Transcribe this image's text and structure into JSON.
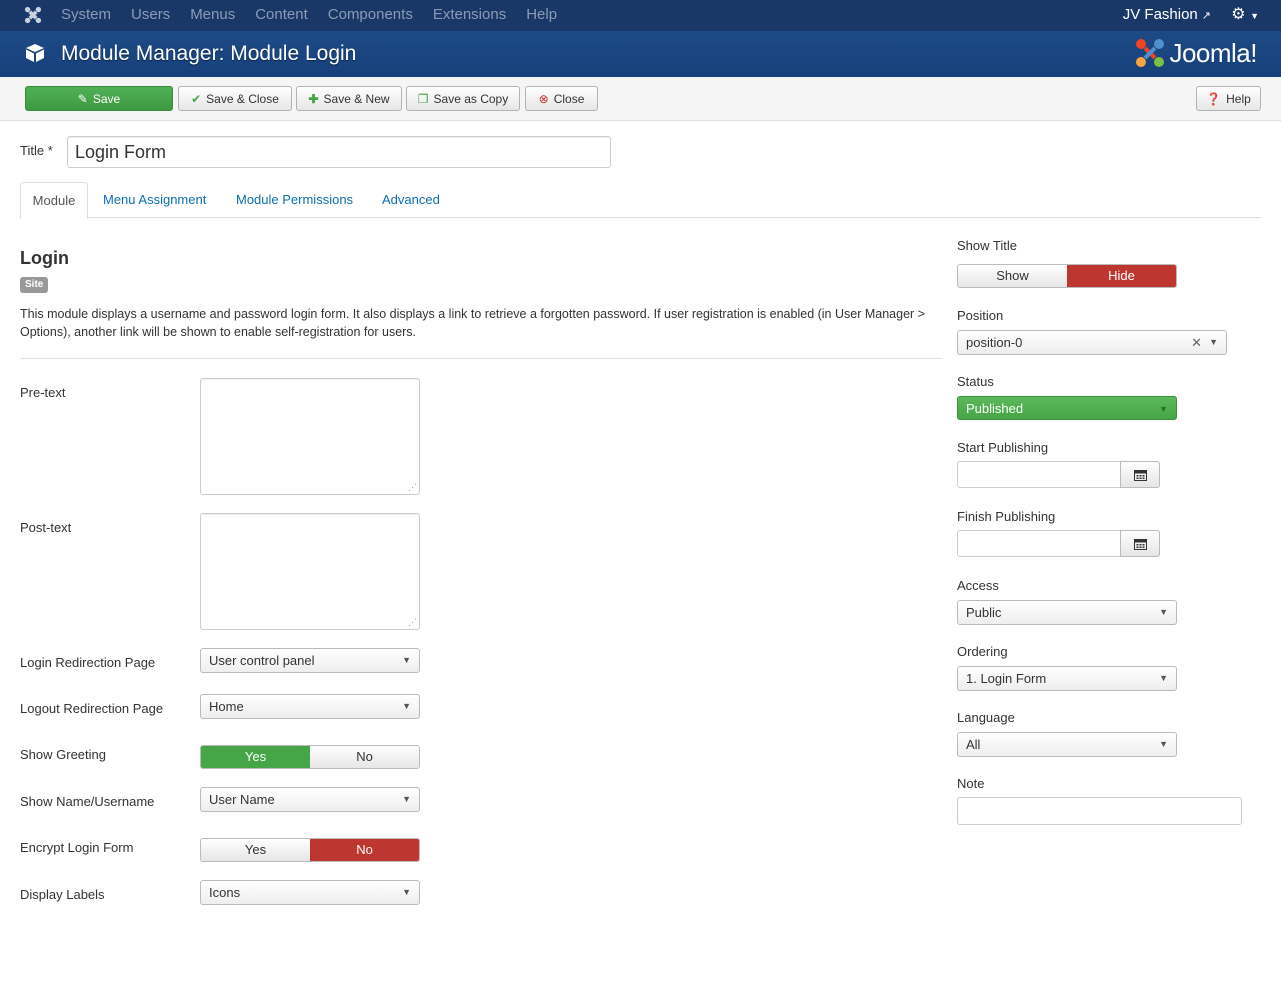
{
  "nav": {
    "menu": [
      "System",
      "Users",
      "Menus",
      "Content",
      "Components",
      "Extensions",
      "Help"
    ],
    "site_name": "JV Fashion"
  },
  "header": {
    "title": "Module Manager: Module Login",
    "brand": "Joomla!"
  },
  "toolbar": {
    "save": "Save",
    "save_close": "Save & Close",
    "save_new": "Save & New",
    "save_copy": "Save as Copy",
    "close": "Close",
    "help": "Help"
  },
  "title_field": {
    "label": "Title *",
    "value": "Login Form"
  },
  "tabs": [
    "Module",
    "Menu Assignment",
    "Module Permissions",
    "Advanced"
  ],
  "module": {
    "name": "Login",
    "badge": "Site",
    "description": "This module displays a username and password login form. It also displays a link to retrieve a forgotten password. If user registration is enabled (in User Manager > Options), another link will be shown to enable self-registration for users."
  },
  "fields": {
    "pretext_label": "Pre-text",
    "posttext_label": "Post-text",
    "login_redirect_label": "Login Redirection Page",
    "login_redirect_value": "User control panel",
    "logout_redirect_label": "Logout Redirection Page",
    "logout_redirect_value": "Home",
    "greeting_label": "Show Greeting",
    "greeting_yes": "Yes",
    "greeting_no": "No",
    "name_label": "Show Name/Username",
    "name_value": "User Name",
    "encrypt_label": "Encrypt Login Form",
    "encrypt_yes": "Yes",
    "encrypt_no": "No",
    "labels_label": "Display Labels",
    "labels_value": "Icons"
  },
  "sidebar": {
    "show_title_label": "Show Title",
    "show": "Show",
    "hide": "Hide",
    "position_label": "Position",
    "position_value": "position-0",
    "status_label": "Status",
    "status_value": "Published",
    "start_label": "Start Publishing",
    "finish_label": "Finish Publishing",
    "access_label": "Access",
    "access_value": "Public",
    "ordering_label": "Ordering",
    "ordering_value": "1. Login Form",
    "language_label": "Language",
    "language_value": "All",
    "note_label": "Note"
  },
  "colors": {
    "navbar": "#1a3867",
    "header": "#1d4a86",
    "success": "#46a546",
    "danger": "#bd362f",
    "link": "#0c6fb0"
  }
}
